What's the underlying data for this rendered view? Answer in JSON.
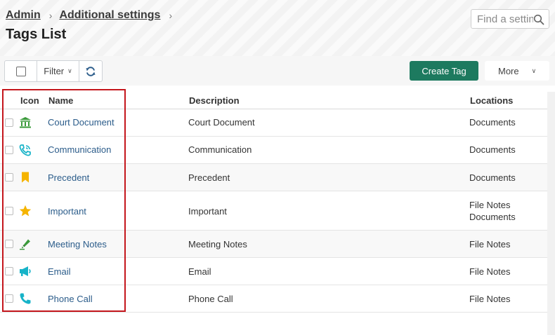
{
  "breadcrumb": {
    "items": [
      {
        "label": "Admin"
      },
      {
        "label": "Additional settings"
      }
    ]
  },
  "page": {
    "title": "Tags List"
  },
  "search": {
    "placeholder": "Find a setting"
  },
  "toolbar": {
    "filter_label": "Filter",
    "create_label": "Create Tag",
    "more_label": "More"
  },
  "table": {
    "headers": {
      "icon": "Icon",
      "name": "Name",
      "description": "Description",
      "locations": "Locations"
    },
    "rows": [
      {
        "icon": "bank-icon",
        "name": "Court Document",
        "description": "Court Document",
        "locations": [
          "Documents"
        ]
      },
      {
        "icon": "phone-call-icon",
        "name": "Communication",
        "description": "Communication",
        "locations": [
          "Documents"
        ]
      },
      {
        "icon": "bookmark-icon",
        "name": "Precedent",
        "description": "Precedent",
        "locations": [
          "Documents"
        ]
      },
      {
        "icon": "star-icon",
        "name": "Important",
        "description": "Important",
        "locations": [
          "File Notes",
          "Documents"
        ]
      },
      {
        "icon": "highlighter-icon",
        "name": "Meeting Notes",
        "description": "Meeting Notes",
        "locations": [
          "File Notes"
        ]
      },
      {
        "icon": "megaphone-icon",
        "name": "Email",
        "description": "Email",
        "locations": [
          "File Notes"
        ]
      },
      {
        "icon": "phone-icon",
        "name": "Phone Call",
        "description": "Phone Call",
        "locations": [
          "File Notes"
        ]
      }
    ]
  },
  "colors": {
    "primary": "#1d7a5f",
    "link": "#2b5c8a",
    "highlight": "#c4161c",
    "icon_green": "#3a9a3a",
    "icon_cyan": "#17b3c8",
    "icon_yellow": "#f5b400"
  }
}
